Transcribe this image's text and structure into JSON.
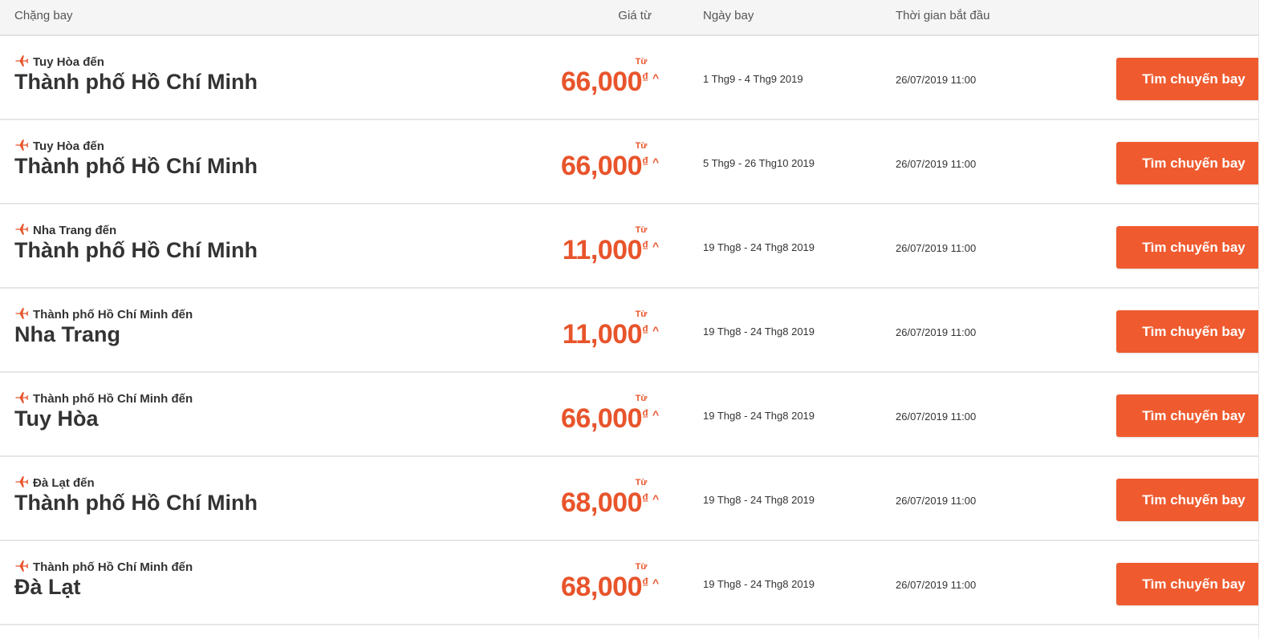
{
  "colors": {
    "accent": "#e8542b",
    "button_bg": "#ef5b2f",
    "header_bg": "#f5f5f5",
    "text": "#333333"
  },
  "header": {
    "route": "Chặng bay",
    "price": "Giá từ",
    "date": "Ngày bay",
    "start": "Thời gian bắt đầu"
  },
  "rows": [
    {
      "icon": "plane-icon",
      "origin": "Tuy Hòa đến",
      "destination": "Thành phố Hồ Chí Minh",
      "from_label": "Từ",
      "price": "66,000",
      "currency": "₫",
      "caret": "^",
      "travel_dates": "1 Thg9 - 4 Thg9 2019",
      "start_time": "26/07/2019 11:00",
      "button_label": "Tìm chuyến bay"
    },
    {
      "icon": "plane-icon",
      "origin": "Tuy Hòa đến",
      "destination": "Thành phố Hồ Chí Minh",
      "from_label": "Từ",
      "price": "66,000",
      "currency": "₫",
      "caret": "^",
      "travel_dates": "5 Thg9 - 26 Thg10 2019",
      "start_time": "26/07/2019 11:00",
      "button_label": "Tìm chuyến bay"
    },
    {
      "icon": "plane-icon",
      "origin": "Nha Trang đến",
      "destination": "Thành phố Hồ Chí Minh",
      "from_label": "Từ",
      "price": "11,000",
      "currency": "₫",
      "caret": "^",
      "travel_dates": "19 Thg8 - 24 Thg8 2019",
      "start_time": "26/07/2019 11:00",
      "button_label": "Tìm chuyến bay"
    },
    {
      "icon": "plane-icon",
      "origin": "Thành phố Hồ Chí Minh đến",
      "destination": "Nha Trang",
      "from_label": "Từ",
      "price": "11,000",
      "currency": "₫",
      "caret": "^",
      "travel_dates": "19 Thg8 - 24 Thg8 2019",
      "start_time": "26/07/2019 11:00",
      "button_label": "Tìm chuyến bay"
    },
    {
      "icon": "plane-icon",
      "origin": "Thành phố Hồ Chí Minh đến",
      "destination": "Tuy Hòa",
      "from_label": "Từ",
      "price": "66,000",
      "currency": "₫",
      "caret": "^",
      "travel_dates": "19 Thg8 - 24 Thg8 2019",
      "start_time": "26/07/2019 11:00",
      "button_label": "Tìm chuyến bay"
    },
    {
      "icon": "plane-icon",
      "origin": "Đà Lạt đến",
      "destination": "Thành phố Hồ Chí Minh",
      "from_label": "Từ",
      "price": "68,000",
      "currency": "₫",
      "caret": "^",
      "travel_dates": "19 Thg8 - 24 Thg8 2019",
      "start_time": "26/07/2019 11:00",
      "button_label": "Tìm chuyến bay"
    },
    {
      "icon": "plane-icon",
      "origin": "Thành phố Hồ Chí Minh đến",
      "destination": "Đà Lạt",
      "from_label": "Từ",
      "price": "68,000",
      "currency": "₫",
      "caret": "^",
      "travel_dates": "19 Thg8 - 24 Thg8 2019",
      "start_time": "26/07/2019 11:00",
      "button_label": "Tìm chuyến bay"
    }
  ]
}
